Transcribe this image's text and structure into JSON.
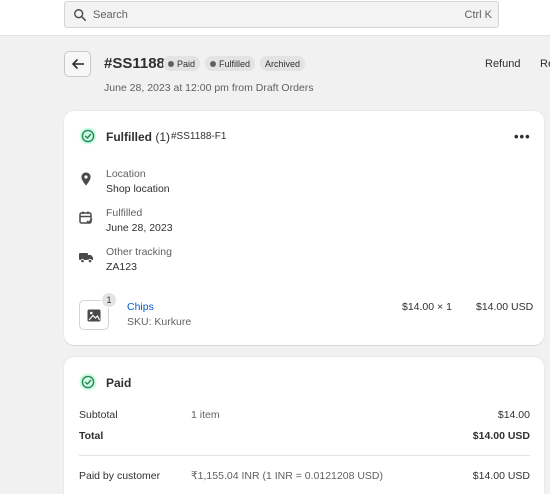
{
  "search": {
    "placeholder": "Search",
    "shortcut": "Ctrl K"
  },
  "order": {
    "title": "#SS1188",
    "badges": [
      "Paid",
      "Fulfilled",
      "Archived"
    ],
    "subtitle": "June 28, 2023 at 12:00 pm from Draft Orders",
    "actions": {
      "refund": "Refund",
      "more": "Re"
    }
  },
  "fulfillment": {
    "heading": "Fulfilled",
    "count": "(1)",
    "id": "#SS1188-F1",
    "location_label": "Location",
    "location_value": "Shop location",
    "fulfilled_label": "Fulfilled",
    "fulfilled_value": "June 28, 2023",
    "tracking_label": "Other tracking",
    "tracking_value": "ZA123",
    "item": {
      "qty": "1",
      "name": "Chips",
      "sku": "SKU: Kurkure",
      "price": "$14.00 × 1",
      "total": "$14.00 USD"
    }
  },
  "payment": {
    "heading": "Paid",
    "subtotal_label": "Subtotal",
    "subtotal_items": "1 item",
    "subtotal_value": "$14.00",
    "total_label": "Total",
    "total_value": "$14.00 USD",
    "paid_label": "Paid by customer",
    "paid_detail": "₹1,155.04 INR (1 INR = 0.0121208 USD)",
    "paid_value": "$14.00 USD"
  },
  "colors": {
    "accent_link": "#005bd3",
    "success": "#29845a",
    "success_bg": "#cdfee1"
  }
}
